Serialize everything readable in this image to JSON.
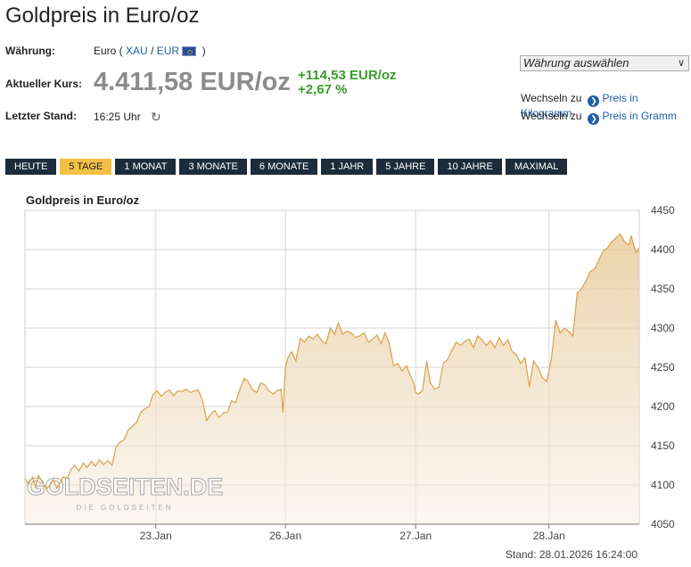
{
  "header": {
    "title": "Goldpreis in Euro/oz"
  },
  "info": {
    "waehrung_label": "Währung:",
    "waehrung_prefix": "Euro (",
    "xau": "XAU",
    "sep": "/",
    "eur": "EUR",
    "suffix": ")",
    "kurs_label": "Aktueller Kurs:",
    "price": "4.411,58 EUR/oz",
    "change_abs": "+114,53 EUR/oz",
    "change_pct": "+2,67 %",
    "stand_label": "Letzter Stand:",
    "stand_time": "16:25 Uhr"
  },
  "currency_select": {
    "selected": "Währung auswählen"
  },
  "switch_links": [
    {
      "prefix": "Wechseln zu",
      "link": "Preis in Kilogramm"
    },
    {
      "prefix": "Wechseln zu",
      "link": "Preis in Gramm"
    }
  ],
  "range_buttons": [
    {
      "label": "HEUTE",
      "active": false
    },
    {
      "label": "5 TAGE",
      "active": true
    },
    {
      "label": "1 MONAT",
      "active": false
    },
    {
      "label": "3 MONATE",
      "active": false
    },
    {
      "label": "6 MONATE",
      "active": false
    },
    {
      "label": "1 JAHR",
      "active": false
    },
    {
      "label": "5 JAHRE",
      "active": false
    },
    {
      "label": "10 JAHRE",
      "active": false
    },
    {
      "label": "MAXIMAL",
      "active": false
    }
  ],
  "watermark": {
    "logo": "GOLDSEITEN.DE",
    "tagline": "DIE GOLDSEITEN"
  },
  "stand_footer": "Stand: 28.01.2026 16:24:00",
  "colors": {
    "accent_active": "#f2c044",
    "button_bg": "#1d2b3a",
    "line": "#d9a24a",
    "positive": "#3a9a2a",
    "link": "#1f5fa8"
  },
  "chart_data": {
    "type": "area",
    "title": "Goldpreis in Euro/oz",
    "ylim": [
      4050,
      4450
    ],
    "yticks": [
      4050,
      4100,
      4150,
      4200,
      4250,
      4300,
      4350,
      4400,
      4450
    ],
    "xlim": [
      0,
      100
    ],
    "xticks": [
      {
        "label": "23.Jan",
        "x": 21.3
      },
      {
        "label": "26.Jan",
        "x": 42.4
      },
      {
        "label": "27.Jan",
        "x": 63.6
      },
      {
        "label": "28.Jan",
        "x": 85.3
      }
    ],
    "grid": true,
    "x": [
      0,
      0.6,
      1.2,
      1.7,
      2.2,
      2.9,
      3.5,
      4.1,
      4.6,
      5.2,
      5.8,
      6.2,
      6.9,
      7.5,
      8.1,
      8.8,
      9.5,
      10.1,
      10.8,
      11.5,
      12.1,
      12.8,
      13.5,
      14.2,
      14.8,
      15.5,
      16.2,
      16.8,
      17.5,
      18.2,
      18.8,
      19.5,
      20.2,
      20.8,
      21.5,
      22.2,
      22.8,
      23.5,
      24.2,
      24.9,
      25.5,
      26.2,
      26.9,
      27.6,
      28.2,
      28.9,
      29.6,
      30.2,
      30.9,
      31.6,
      32.3,
      33.0,
      33.6,
      34.3,
      35.0,
      35.7,
      36.3,
      37.0,
      37.7,
      38.4,
      39.0,
      39.7,
      40.4,
      41.0,
      41.7,
      42.0,
      42.4,
      42.8,
      43.4,
      44.1,
      44.8,
      45.5,
      46.2,
      46.9,
      47.6,
      48.3,
      49.0,
      49.7,
      50.4,
      51.0,
      51.7,
      52.4,
      53.1,
      53.8,
      54.5,
      55.2,
      55.9,
      56.6,
      57.3,
      58.0,
      58.6,
      59.3,
      60.0,
      60.7,
      61.4,
      62.1,
      62.8,
      63.3,
      63.6,
      64.0,
      64.7,
      65.4,
      66.0,
      66.7,
      67.4,
      68.1,
      68.8,
      69.5,
      70.2,
      70.9,
      71.6,
      72.3,
      73.0,
      73.7,
      74.4,
      75.1,
      75.8,
      76.5,
      77.2,
      77.9,
      78.6,
      79.3,
      80.0,
      80.7,
      81.4,
      82.1,
      82.8,
      83.5,
      84.2,
      84.9,
      85.3,
      85.7,
      86.4,
      87.1,
      87.8,
      88.5,
      89.2,
      89.9,
      90.6,
      91.3,
      92.0,
      92.7,
      93.4,
      94.1,
      94.8,
      95.5,
      96.2,
      96.9,
      97.6,
      98.3,
      98.7,
      99.1,
      99.5,
      100
    ],
    "values": [
      4108,
      4101,
      4110,
      4098,
      4112,
      4103,
      4095,
      4100,
      4107,
      4096,
      4104,
      4110,
      4109,
      4120,
      4125,
      4118,
      4128,
      4122,
      4130,
      4124,
      4132,
      4126,
      4131,
      4125,
      4148,
      4155,
      4158,
      4170,
      4175,
      4180,
      4192,
      4197,
      4200,
      4215,
      4220,
      4213,
      4218,
      4221,
      4214,
      4220,
      4219,
      4222,
      4218,
      4220,
      4221,
      4208,
      4182,
      4190,
      4195,
      4186,
      4192,
      4193,
      4207,
      4205,
      4222,
      4236,
      4232,
      4222,
      4218,
      4230,
      4228,
      4220,
      4216,
      4220,
      4222,
      4192,
      4250,
      4262,
      4270,
      4258,
      4287,
      4282,
      4290,
      4286,
      4292,
      4284,
      4280,
      4300,
      4292,
      4306,
      4292,
      4296,
      4294,
      4288,
      4290,
      4294,
      4282,
      4286,
      4291,
      4280,
      4294,
      4280,
      4252,
      4255,
      4245,
      4252,
      4238,
      4230,
      4218,
      4216,
      4220,
      4258,
      4230,
      4222,
      4225,
      4255,
      4260,
      4272,
      4282,
      4278,
      4283,
      4286,
      4275,
      4290,
      4285,
      4278,
      4284,
      4275,
      4288,
      4278,
      4285,
      4270,
      4266,
      4255,
      4262,
      4225,
      4258,
      4250,
      4237,
      4232,
      4245,
      4262,
      4310,
      4294,
      4300,
      4296,
      4290,
      4345,
      4350,
      4360,
      4372,
      4375,
      4386,
      4398,
      4402,
      4410,
      4415,
      4420,
      4410,
      4406,
      4418,
      4405,
      4396,
      4402,
      4411,
      4430,
      4412
    ]
  }
}
